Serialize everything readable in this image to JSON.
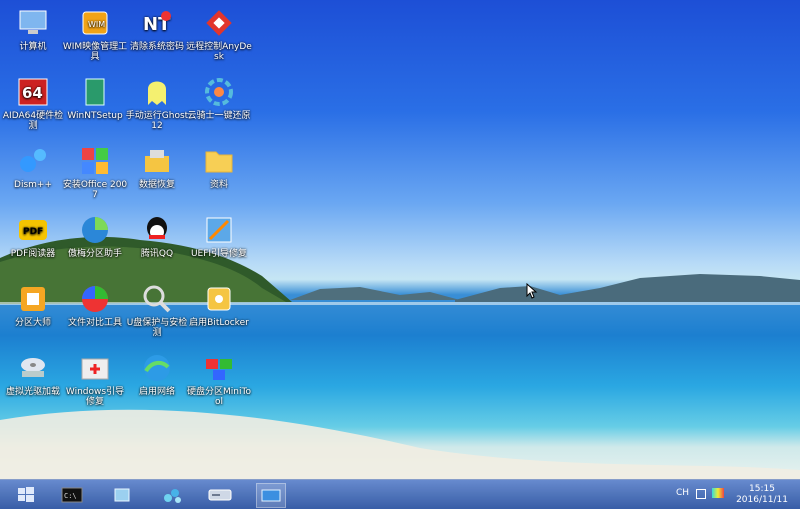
{
  "desktop_icons": [
    {
      "label": "计算机",
      "icon": "computer-icon"
    },
    {
      "label": "WIM映像管理工具",
      "icon": "wim-tool-icon"
    },
    {
      "label": "清除系统密码",
      "icon": "password-reset-icon"
    },
    {
      "label": "远程控制AnyDesk",
      "icon": "anydesk-icon"
    },
    {
      "label": "AIDA64硬件检测",
      "icon": "aida64-icon"
    },
    {
      "label": "WinNTSetup",
      "icon": "winntsetup-icon"
    },
    {
      "label": "手动运行Ghost12",
      "icon": "ghost-icon"
    },
    {
      "label": "云骑士一键还原",
      "icon": "restore-icon"
    },
    {
      "label": "Dism++",
      "icon": "dism-icon"
    },
    {
      "label": "安装Office 2007",
      "icon": "office-icon"
    },
    {
      "label": "数据恢复",
      "icon": "data-recovery-icon"
    },
    {
      "label": "资料",
      "icon": "folder-icon"
    },
    {
      "label": "PDF阅读器",
      "icon": "pdf-icon"
    },
    {
      "label": "傲梅分区助手",
      "icon": "partition-assistant-icon"
    },
    {
      "label": "腾讯QQ",
      "icon": "qq-icon"
    },
    {
      "label": "UEFI引导修复",
      "icon": "uefi-repair-icon"
    },
    {
      "label": "分区大师",
      "icon": "partition-master-icon"
    },
    {
      "label": "文件对比工具",
      "icon": "file-compare-icon"
    },
    {
      "label": "U盘保护与安检测",
      "icon": "usb-check-icon"
    },
    {
      "label": "启用BitLocker",
      "icon": "bitlocker-icon"
    },
    {
      "label": "虚拟光驱加载",
      "icon": "virtual-drive-icon"
    },
    {
      "label": "Windows引导修复",
      "icon": "boot-repair-icon"
    },
    {
      "label": "启用网络",
      "icon": "network-icon"
    },
    {
      "label": "硬盘分区MiniTool",
      "icon": "minitool-icon"
    }
  ],
  "taskbar": {
    "buttons": [
      "windows-start-icon",
      "cmd-icon",
      "explorer-icon",
      "tools-icon",
      "drive-icon",
      "screen-window-icon"
    ],
    "tray_lang": "CH",
    "time": "15:15",
    "date": "2016/11/11"
  }
}
